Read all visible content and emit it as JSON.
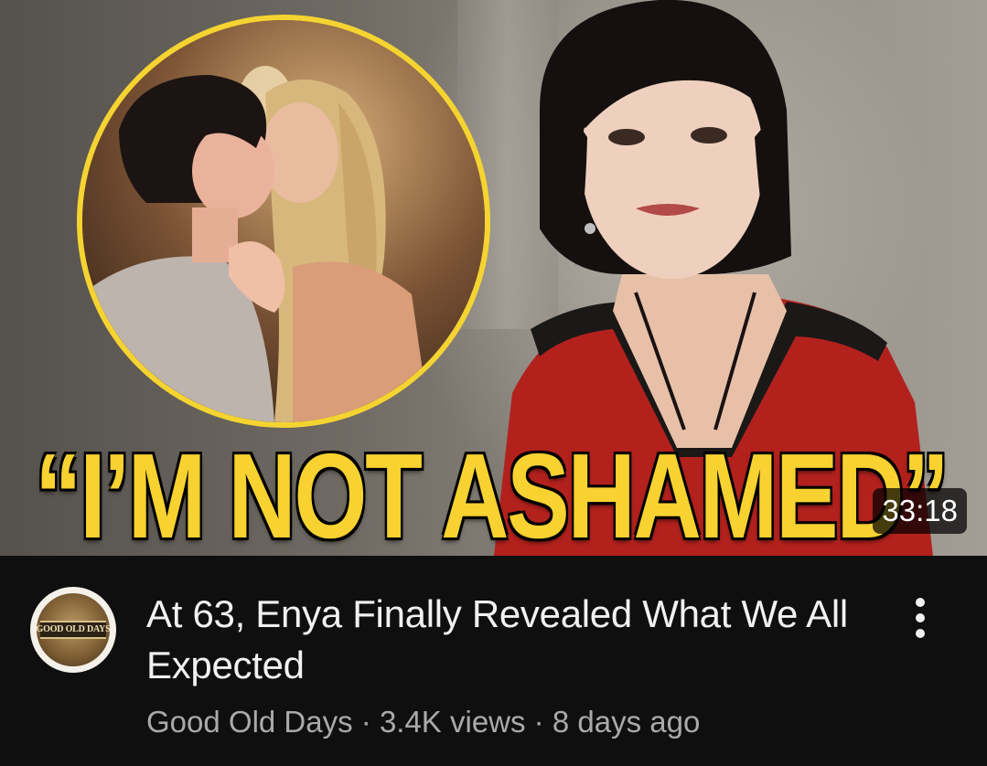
{
  "video": {
    "thumbnail": {
      "headline": "“I’M NOT ASHAMED”",
      "duration": "33:18",
      "accent_color": "#f7d230",
      "circle_border_color": "#f5d431"
    },
    "title": "At 63, Enya Finally Revealed What We All Expected",
    "channel": {
      "name": "Good Old Days",
      "avatar_text": "GOOD OLD DAYS"
    },
    "separator": " · ",
    "views": "3.4K views",
    "age": "8 days ago",
    "menu_icon": "more-vert-icon"
  },
  "theme": {
    "background": "#0f0f0f",
    "title_color": "#f1f1f1",
    "meta_color": "#aaaaaa"
  }
}
